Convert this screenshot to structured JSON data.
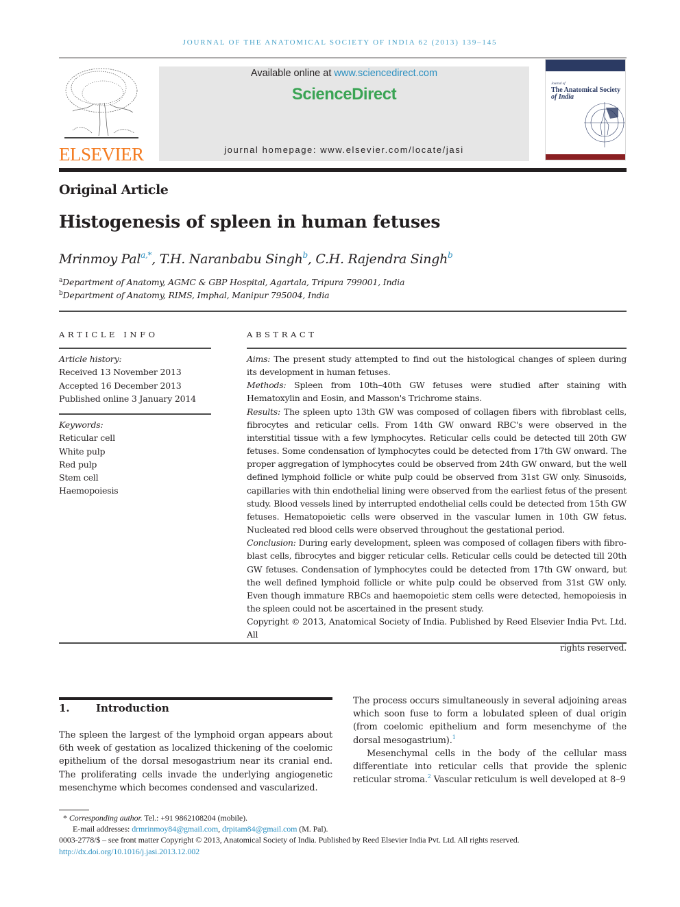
{
  "running_head": "Journal of the Anatomical Society of India 62 (2013) 139–145",
  "header": {
    "publisher_word": "ELSEVIER",
    "available_prefix": "Available online at ",
    "available_link": "www.sciencedirect.com",
    "sd_logo": "ScienceDirect",
    "homepage": "journal homepage: www.elsevier.com/locate/jasi",
    "cover": {
      "small_label": "Journal of",
      "title_line1": "The Anatomical Society",
      "title_line2": "of India"
    },
    "colors": {
      "elsevier_orange": "#f47b20",
      "sd_green": "#3aa454",
      "link_blue": "#2a8fc0"
    }
  },
  "article": {
    "type": "Original Article",
    "title": "Histogenesis of spleen in human fetuses",
    "authors": [
      {
        "name": "Mrinmoy Pal",
        "sup": "a,*",
        "sep": ", "
      },
      {
        "name": "T.H. Naranbabu Singh",
        "sup": "b",
        "sep": ", "
      },
      {
        "name": "C.H. Rajendra Singh",
        "sup": "b",
        "sep": ""
      }
    ],
    "affiliations": [
      {
        "mark": "a",
        "text": "Department of Anatomy, AGMC & GBP Hospital, Agartala, Tripura 799001, India"
      },
      {
        "mark": "b",
        "text": "Department of Anatomy, RIMS, Imphal, Manipur 795004, India"
      }
    ]
  },
  "article_info": {
    "label": "ARTICLE INFO",
    "history_label": "Article history:",
    "history": [
      "Received 13 November 2013",
      "Accepted 16 December 2013",
      "Published online 3 January 2014"
    ],
    "keywords_label": "Keywords:",
    "keywords": [
      "Reticular cell",
      "White pulp",
      "Red pulp",
      "Stem cell",
      "Haemopoiesis"
    ]
  },
  "abstract": {
    "label": "ABSTRACT",
    "sections": [
      {
        "label": "Aims:",
        "text": " The present study attempted to find out the histological changes of spleen during its development in human fetuses."
      },
      {
        "label": "Methods:",
        "text": " Spleen from 10th–40th GW fetuses were studied after staining with Hematoxylin and Eosin, and Masson's Trichrome stains."
      },
      {
        "label": "Results:",
        "text": " The spleen upto 13th GW was composed of collagen fibers with fibroblast cells, fibrocytes and reticular cells. From 14th GW onward RBC's were observed in the interstitial tissue with a few lymphocytes. Reticular cells could be detected till 20th GW fetuses. Some condensation of lymphocytes could be detected from 17th GW onward. The proper aggregation of lymphocytes could be observed from 24th GW onward, but the well defined lymphoid follicle or white pulp could be observed from 31st GW only. Sinusoids, capillaries with thin endothelial lining were observed from the earliest fetus of the present study. Blood vessels lined by interrupted endothelial cells could be detected from 15th GW fetuses. Hematopoietic cells were observed in the vascular lumen in 10th GW fetus. Nucleated red blood cells were observed throughout the gestational period."
      },
      {
        "label": "Conclusion:",
        "text": " During early development, spleen was composed of collagen fibers with fibro­blast cells, fibrocytes and bigger reticular cells. Reticular cells could be detected till 20th GW fetuses. Condensation of lymphocytes could be detected from 17th GW onward, but the well defined lymphoid follicle or white pulp could be observed from 31st GW only. Even though immature RBCs and haemopoietic stem cells were detected, hemopoiesis in the spleen could not be ascertained in the present study."
      }
    ],
    "copyright_main": "Copyright © 2013, Anatomical Society of India. Published by Reed Elsevier India Pvt. Ltd. All",
    "copyright_end": "rights reserved."
  },
  "intro": {
    "number": "1.",
    "heading": "Introduction",
    "left_para": "The spleen the largest of the lymphoid organ appears about 6th week of gestation as localized thickening of the coelomic epithelium of the dorsal mesogastrium near its cranial end. The proliferating cells invade the underlying angiogenetic mesenchyme which becomes condensed and vascularized.",
    "right_para1": "The process occurs simultaneously in several adjoining areas which soon fuse to form a lobulated spleen of dual origin (from coelomic epithelium and form mesenchyme of the dorsal mesogastrium).",
    "right_para1_ref": "1",
    "right_para2_a": "Mesenchymal cells in the body of the cellular mass differentiate into reticular cells that provide the splenic reticular stroma.",
    "right_para2_ref": "2",
    "right_para2_b": " Vascular reticulum is well developed at 8–9"
  },
  "footnotes": {
    "corr_mark": "*",
    "corr_label": "Corresponding author.",
    "corr_text": " Tel.: +91 9862108204 (mobile).",
    "email_label": "E-mail addresses: ",
    "email1": "drmrinmoy84@gmail.com",
    "email_sep": ", ",
    "email2": "drpitam84@gmail.com",
    "email_suffix": " (M. Pal).",
    "issn_line": "0003-2778/$ – see front matter Copyright © 2013, Anatomical Society of India. Published by Reed Elsevier India Pvt. Ltd. All rights reserved.",
    "doi": "http://dx.doi.org/10.1016/j.jasi.2013.12.002"
  }
}
